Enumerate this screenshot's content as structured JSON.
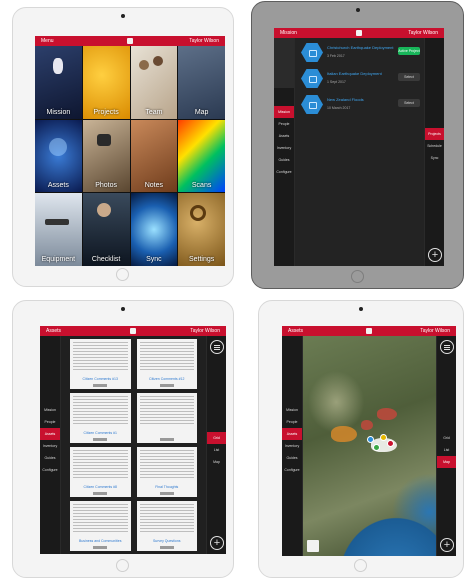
{
  "user": "Taylor Wilson",
  "tablet1": {
    "title": "Menu",
    "tiles": [
      {
        "label": "Mission"
      },
      {
        "label": "Projects"
      },
      {
        "label": "Team"
      },
      {
        "label": "Map"
      },
      {
        "label": "Assets"
      },
      {
        "label": "Photos"
      },
      {
        "label": "Notes"
      },
      {
        "label": "Scans"
      },
      {
        "label": "Equipment"
      },
      {
        "label": "Checklist"
      },
      {
        "label": "Sync"
      },
      {
        "label": "Settings"
      }
    ]
  },
  "tablet2": {
    "title": "Mission",
    "left_nav": [
      "Mission",
      "People",
      "Assets",
      "Inventory",
      "Guides",
      "Configure"
    ],
    "right_nav": [
      "Projects",
      "Schedule",
      "Sync"
    ],
    "projects": [
      {
        "title": "Christchurch Earthquake Deployment",
        "date": "3 Feb 2017",
        "action": "Active Project"
      },
      {
        "title": "Italian Earthquake Deployment",
        "date": "1 Sept 2017",
        "action": "Select"
      },
      {
        "title": "New Zealand Floods",
        "date": "10 March 2017",
        "action": "Select"
      }
    ]
  },
  "tablet3": {
    "title": "Assets",
    "left_nav": [
      "Mission",
      "People",
      "Assets",
      "Inventory",
      "Guides",
      "Configure"
    ],
    "right_nav": [
      "Grid",
      "List",
      "Map"
    ],
    "cards": [
      {
        "title": ""
      },
      {
        "title": ""
      },
      {
        "title": "Citizen Comments #13"
      },
      {
        "title": "Citizen Comments #12"
      },
      {
        "title": ""
      },
      {
        "title": "Citizen Comments #1"
      },
      {
        "title": "Citizen Comments #8"
      },
      {
        "title": "Final Thoughts"
      },
      {
        "title": "Business and Communities"
      },
      {
        "title": "Survey Questions"
      }
    ]
  },
  "tablet4": {
    "title": "Assets",
    "left_nav": [
      "Mission",
      "People",
      "Assets",
      "Inventory",
      "Guides",
      "Configure"
    ],
    "right_nav": [
      "Grid",
      "List",
      "Map"
    ]
  },
  "colors": {
    "accent": "#c8102e",
    "link": "#3fa9f5",
    "active_green": "#18b65a"
  }
}
